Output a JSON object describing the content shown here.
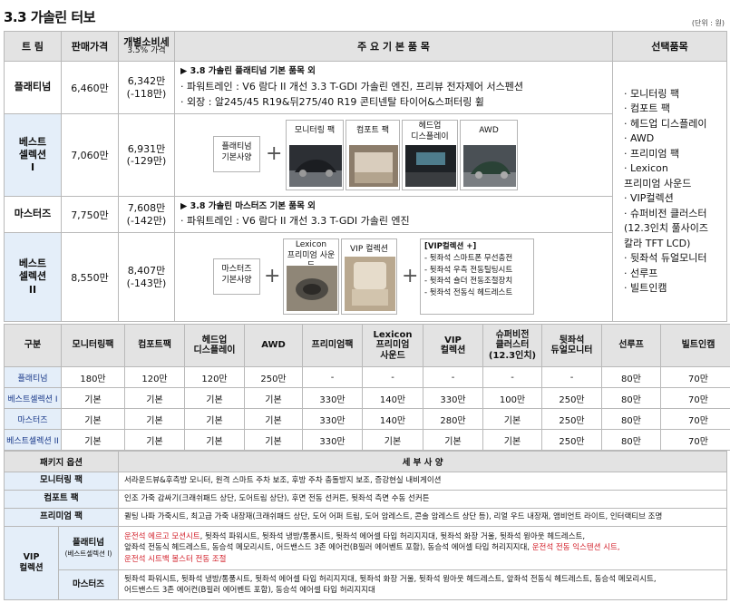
{
  "page": {
    "title": "3.3 가솔린 터보",
    "unit": "(단위 : 원)"
  },
  "main": {
    "headers": {
      "trim": "트 림",
      "price": "판매가격",
      "indiv_tax": "개별소비세",
      "indiv_rate": "3.5% 가격",
      "items": "주 요 기 본 품 목",
      "options": "선택품목"
    },
    "rows": [
      {
        "name": "플래티넘",
        "price": "6,460만",
        "indiv": "6,342만",
        "indiv_diff": "(-118만)"
      },
      {
        "name_line1": "베스트",
        "name_line2": "셀렉션",
        "name_line3": "I",
        "price": "7,060만",
        "indiv": "6,931만",
        "indiv_diff": "(-129만)"
      },
      {
        "name": "마스터즈",
        "price": "7,750만",
        "indiv": "7,608만",
        "indiv_diff": "(-142만)"
      },
      {
        "name_line1": "베스트",
        "name_line2": "셀렉션",
        "name_line3": "II",
        "price": "8,550만",
        "indiv": "8,407만",
        "indiv_diff": "(-143만)"
      }
    ],
    "platinum_items": {
      "head": "▶ 3.8 가솔린 플래티넘 기본 품목 외",
      "line1": "· 파워트레인 : V6 람다 II  개선 3.3 T-GDI 가솔린 엔진, 프리뷰 전자제어 서스펜션",
      "line2": "· 외장 : 알245/45 R19&뒤275/40 R19 콘티넨탈 타이어&스퍼터링 휠"
    },
    "masters_items": {
      "head": "▶ 3.8 가솔린 마스터즈 기본 품목 외",
      "line1": "· 파워트레인 : V6 람다 II  개선 3.3 T-GDI 가솔린 엔진"
    },
    "best1_combo": {
      "base_line1": "플래티넘",
      "base_line2": "기본사양",
      "plus": "+",
      "p1": "모니터링 팩",
      "p2": "컴포트 팩",
      "p3_line1": "헤드업",
      "p3_line2": "디스플레이",
      "p4": "AWD"
    },
    "best2_combo": {
      "base_line1": "마스터즈",
      "base_line2": "기본사양",
      "plus": "+",
      "p1_line1": "Lexicon",
      "p1_line2": "프리미엄 사운드",
      "p2": "VIP 컬렉션",
      "vip_title": "[VIP컬렉션 +]",
      "vip_items": [
        "- 뒷좌석 스마트폰 무선충전",
        "- 뒷좌석 우측 전동틸팅시트",
        "- 뒷좌석 숄더 전동조절장치",
        "- 뒷좌석 전동식 헤드레스트"
      ]
    },
    "options": [
      "· 모니터링 팩",
      "· 컴포트 팩",
      "· 헤드업 디스플레이",
      "· AWD",
      "· 프리미엄 팩",
      "· Lexicon",
      "  프리미엄 사운드",
      "· VIP컬렉션",
      "· 슈퍼비전 클러스터",
      "  (12.3인치 풀사이즈",
      "  칼라 TFT LCD)",
      "· 뒷좌석 듀얼모니터",
      "· 선루프",
      "· 빌트인캠"
    ]
  },
  "compare": {
    "headers": [
      {
        "l1": "구분"
      },
      {
        "l1": "모니터링팩"
      },
      {
        "l1": "컴포트팩"
      },
      {
        "l1": "헤드업",
        "l2": "디스플레이"
      },
      {
        "l1": "AWD"
      },
      {
        "l1": "프리미엄팩"
      },
      {
        "l1": "Lexicon",
        "l2": "프리미엄",
        "l3": "사운드"
      },
      {
        "l1": "VIP",
        "l2": "컬렉션"
      },
      {
        "l1": "슈퍼비전",
        "l2": "클러스터",
        "l3": "(12.3인치)"
      },
      {
        "l1": "뒷좌석",
        "l2": "듀얼모니터"
      },
      {
        "l1": "선루프"
      },
      {
        "l1": "빌트인캠"
      }
    ],
    "rows": [
      {
        "label": "플래티넘",
        "cells": [
          "180만",
          "120만",
          "120만",
          "250만",
          "-",
          "-",
          "-",
          "-",
          "-",
          "80만",
          "70만"
        ]
      },
      {
        "label": "베스트셀렉션 I",
        "cells": [
          "기본",
          "기본",
          "기본",
          "기본",
          "330만",
          "140만",
          "330만",
          "100만",
          "250만",
          "80만",
          "70만"
        ]
      },
      {
        "label": "마스터즈",
        "cells": [
          "기본",
          "기본",
          "기본",
          "기본",
          "330만",
          "140만",
          "280만",
          "기본",
          "250만",
          "80만",
          "70만"
        ]
      },
      {
        "label": "베스트셀렉션 II",
        "cells": [
          "기본",
          "기본",
          "기본",
          "기본",
          "330만",
          "기본",
          "기본",
          "기본",
          "250만",
          "80만",
          "70만"
        ]
      }
    ]
  },
  "packages": {
    "headers": {
      "option": "패키지 옵션",
      "detail": "세 부 사 양"
    },
    "monitoring": {
      "name": "모니터링 팩",
      "desc": "서라운드뷰&후측방 모니터, 원격 스마트 주차 보조, 후방 주차 충돌방지 보조, 증강현실 내비게이션"
    },
    "comfort": {
      "name": "컴포트 팩",
      "desc": "인조 가죽 감싸기(크래쉬패드 상단, 도어트림 상단), 후면 전동 선커튼, 뒷좌석 측면 수동 선커튼"
    },
    "premium": {
      "name": "프리미엄 팩",
      "desc": "퀼팅 나파 가죽시트, 최고급 가죽 내장재(크래쉬패드 상단, 도어 어퍼 트림, 도어 암레스트, 콘솔 암레스트 상단 등), 리얼 우드 내장재, 앰비언트 라이트, 인터랙티브 조명"
    },
    "vip": {
      "name_line1": "VIP",
      "name_line2": "컬렉션",
      "platinum_label": "플래티넘",
      "platinum_sub": "(베스트셀렉션 I)",
      "platinum_desc_red1": "운전석 에르고 모션시트",
      "platinum_desc_1": ", 뒷좌석 파워시트, 뒷좌석 냉방/통풍시트, 뒷좌석 에어셀 타입 허리지지대, 뒷좌석 화장 거울, 뒷좌석 윙아웃 헤드레스트,",
      "platinum_desc_2a": "앞좌석 전동식 헤드레스트, 동승석 메모리시트, 어드밴스드 3존 에어컨(B필러 에어벤트 포함), 동승석 에어셀 타입 허리지지대, ",
      "platinum_desc_red2": "운전석 전동 익스텐션 시트,",
      "platinum_desc_red3": "운전석 시트백 볼스터 전동 조절",
      "masters_label": "마스터즈",
      "masters_desc_1": "뒷좌석 파워시트, 뒷좌석 냉방/통풍시트, 뒷좌석 에어셀 타입 허리지지대, 뒷좌석 화장 거울, 뒷좌석 윙아웃 헤드레스트, 앞좌석 전동식 헤드레스트, 동승석 메모리시트,",
      "masters_desc_2": "어드밴스드 3존 에어컨(B필러 에어벤트 포함), 동승석 에어셀 타입 허리지지대"
    }
  },
  "colors": {
    "header_bg": "#e3e3e3",
    "trim_bg": "#e4eef9",
    "accent_red": "#d21d27"
  }
}
